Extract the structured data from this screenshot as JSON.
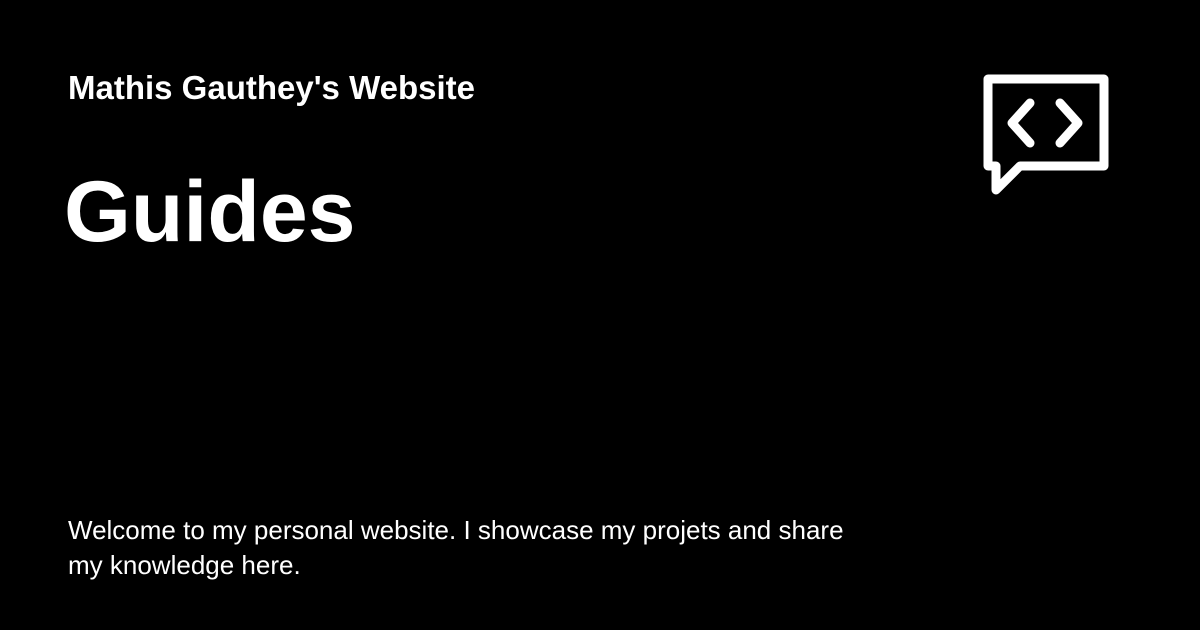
{
  "site": {
    "name": "Mathis Gauthey's Website",
    "logo_icon": "code-chat-icon"
  },
  "page": {
    "title": "Guides",
    "description": "Welcome to my personal website. I showcase my projets and share my knowledge here."
  },
  "colors": {
    "background": "#000000",
    "text": "#ffffff"
  }
}
